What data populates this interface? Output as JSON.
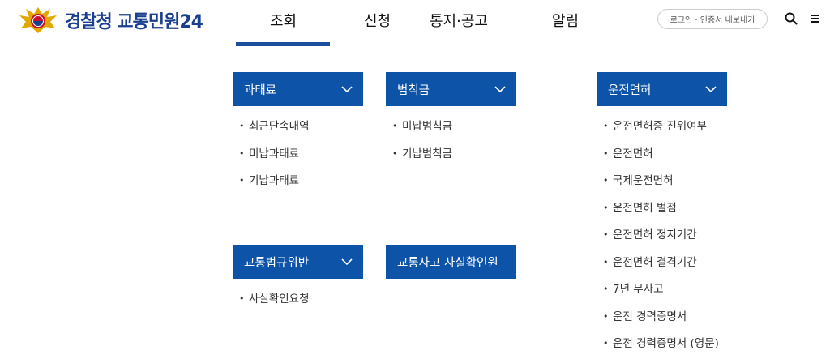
{
  "header": {
    "logo_text": "경찰청 교통민원24",
    "nav": [
      "조회",
      "신청",
      "통지·공고",
      "알림"
    ],
    "login_label": "로그인 · 인증서 내보내기",
    "search_icon": "search-icon",
    "menu_icon": "hamburger-menu-icon",
    "accent_color": "#1b4e9b"
  },
  "sections": {
    "fines": {
      "title": "과태료",
      "items": [
        "최근단속내역",
        "미납과태료",
        "기납과태료"
      ]
    },
    "penalty": {
      "title": "범칙금",
      "items": [
        "미납범칙금",
        "기납범칙금"
      ]
    },
    "license": {
      "title": "운전면허",
      "items": [
        "운전면허증 진위여부",
        "운전면허",
        "국제운전면허",
        "운전면허 벌점",
        "운전면허 정지기간",
        "운전면허 결격기간",
        "7년 무사고",
        "운전 경력증명서",
        "운전 경력증명서 (영문)"
      ]
    },
    "violation": {
      "title": "교통법규위반",
      "items": [
        "사실확인요청"
      ]
    },
    "accident": {
      "title": "교통사고 사실확인원"
    }
  },
  "colors": {
    "section_header_bg": "#0d53a8",
    "logo_text": "#1b3f8f"
  }
}
